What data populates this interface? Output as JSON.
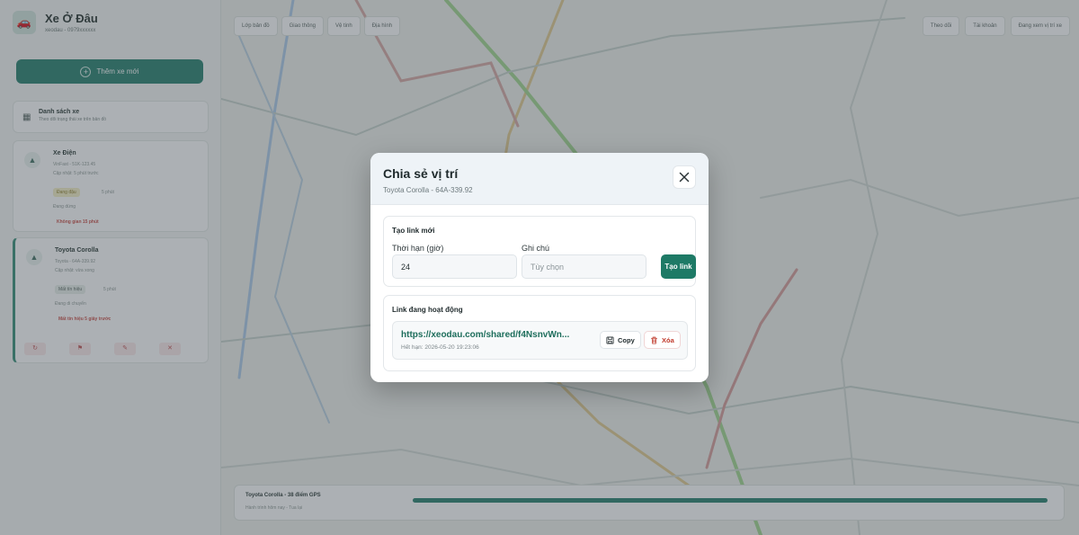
{
  "app": {
    "name": "Xe Ở Đâu",
    "subtitle": "xeodau - 0979xxxxxx",
    "add_button": "Thêm xe mới"
  },
  "vehicle_list": {
    "title": "Danh sách xe",
    "subtitle": "Theo dõi trạng thái xe trên bản đồ",
    "items": [
      {
        "name": "Xe Điện",
        "line1": "VinFast - 51K-123.45",
        "line2": "Cập nhật: 5 phút trước",
        "tag": "Đang đậu",
        "tag2": "5 phút",
        "status": "Đang dừng",
        "warn": "Không gian 15 phút"
      },
      {
        "name": "Toyota Corolla",
        "line1": "Toyota - 64A-339.92",
        "line2": "Cập nhật: vừa xong",
        "tag": "Mất tín hiệu",
        "tag2": "5 phút",
        "status": "Đang di chuyển",
        "warn": "Mất tín hiệu 5 giây trước"
      }
    ]
  },
  "map": {
    "chips": [
      "Lớp bản đồ",
      "Giao thông",
      "Vệ tinh",
      "Địa hình"
    ],
    "top_right": [
      "Theo dõi",
      "Tài khoản",
      "Đang xem vị trí xe"
    ],
    "bottom_title": "Toyota Corolla - 38 điểm GPS",
    "bottom_sub": "Hành trình hôm nay - Tua lại"
  },
  "modal": {
    "title": "Chia sẻ vị trí",
    "subtitle": "Toyota Corolla - 64A-339.92",
    "new_link": {
      "title": "Tạo link mới",
      "duration_label": "Thời hạn (giờ)",
      "duration_value": "24",
      "note_label": "Ghi chú",
      "note_placeholder": "Tùy chọn",
      "create_button": "Tạo link"
    },
    "active_links": {
      "title": "Link đang hoạt động",
      "items": [
        {
          "url": "https://xeodau.com/shared/f4NsnvWn...",
          "expires": "Hết hạn: 2026-05-20 19:23:06",
          "copy_label": "Copy",
          "delete_label": "Xóa"
        }
      ]
    }
  },
  "colors": {
    "accent": "#1e7a66",
    "danger": "#c0392b",
    "overlay": "rgba(70, 80, 88, 0.45)"
  }
}
